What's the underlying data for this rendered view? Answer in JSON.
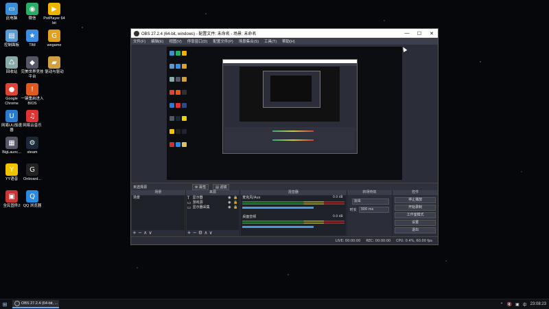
{
  "desktop": {
    "icons": [
      {
        "label": "此电脑",
        "color": "#3b8fd6",
        "glyph": "▭"
      },
      {
        "label": "微信",
        "color": "#2aae67",
        "glyph": "◉"
      },
      {
        "label": "PotPlayer 64 bit",
        "color": "#f0b400",
        "glyph": "▶"
      },
      {
        "label": "控制面板",
        "color": "#5a9bd5",
        "glyph": "▤"
      },
      {
        "label": "TIM",
        "color": "#3c8de0",
        "glyph": "★"
      },
      {
        "label": "wegame",
        "color": "#e0a020",
        "glyph": "G"
      },
      {
        "label": "回收站",
        "color": "#8aa",
        "glyph": "♺"
      },
      {
        "label": "完美世界竞技平台",
        "color": "#556",
        "glyph": "◆"
      },
      {
        "label": "驱动与驱动",
        "color": "#d0a040",
        "glyph": "▰"
      },
      {
        "label": "Google Chrome",
        "color": "#db4437",
        "glyph": "●"
      },
      {
        "label": "一键重启进入BIOS",
        "color": "#e05a20",
        "glyph": "!"
      },
      {
        "label": "OBS Studio",
        "color": "#303030",
        "glyph": "◎"
      },
      {
        "label": "网易UU加速器",
        "color": "#2a7ad0",
        "glyph": "U"
      },
      {
        "label": "网易云音乐",
        "color": "#d33",
        "glyph": "♫"
      },
      {
        "label": "TeamSpeak 3",
        "color": "#2a4a8a",
        "glyph": "◐"
      },
      {
        "label": "BigLaunc...",
        "color": "#556",
        "glyph": "▦"
      },
      {
        "label": "steam",
        "color": "#1b2838",
        "glyph": "⚙"
      },
      {
        "label": "QQ音乐",
        "color": "#f5d000",
        "glyph": "♪"
      },
      {
        "label": "YY语音",
        "color": "#f2c300",
        "glyph": "Y"
      },
      {
        "label": "Onboard...",
        "color": "#222",
        "glyph": "G"
      },
      {
        "label": "5E对战平台",
        "color": "#223",
        "glyph": "5"
      },
      {
        "label": "全民固件2",
        "color": "#c33",
        "glyph": "▣"
      },
      {
        "label": "QQ 浏览器",
        "color": "#2a8ae0",
        "glyph": "Q"
      },
      {
        "label": "cfg",
        "color": "#e0c060",
        "glyph": "▭"
      }
    ]
  },
  "obs": {
    "title": "OBS 27.2.4 (64-bit, windows) - 配置文件: 未命名 - 场景: 未命名",
    "menu": [
      "文件(F)",
      "编辑(E)",
      "视图(V)",
      "停靠窗口(D)",
      "配置文件(P)",
      "场景集合(S)",
      "工具(T)",
      "帮助(H)"
    ],
    "no_source": "未选择源",
    "props_btn": "属性",
    "filters_btn": "滤镜",
    "docks": {
      "scenes": {
        "title": "场景",
        "items": [
          "场景"
        ],
        "foot": "+ − ∧ ∨"
      },
      "sources": {
        "title": "来源",
        "items": [
          {
            "icon": "T",
            "name": "显示器"
          },
          {
            "icon": "▭",
            "name": "游戏源"
          },
          {
            "icon": "▭",
            "name": "显示器采集"
          }
        ],
        "foot": "+ − ⚙ ∧ ∨"
      },
      "mixer": {
        "title": "混音器",
        "channels": [
          {
            "name": "麦克风/Aux",
            "db": "0.0 dB"
          },
          {
            "name": "桌面音频",
            "db": "0.0 dB"
          }
        ]
      },
      "transitions": {
        "title": "转场特效",
        "fade": "淡出",
        "duration_label": "时长",
        "duration": "300 ms"
      },
      "controls": {
        "title": "控件",
        "buttons": [
          "停止播放",
          "开始录制",
          "工作室模式",
          "设置",
          "退出"
        ]
      }
    },
    "status": {
      "live": "LIVE: 00:00:00",
      "rec": "REC: 00:00:00",
      "cpu": "CPU: 0.4%, 60.00 fps"
    }
  },
  "taskbar": {
    "task_label": "OBS 27.2.4 (64-bit, ...",
    "clock": "23:08:23",
    "tray": [
      "⌃",
      "🔇",
      "▣",
      "中"
    ]
  }
}
